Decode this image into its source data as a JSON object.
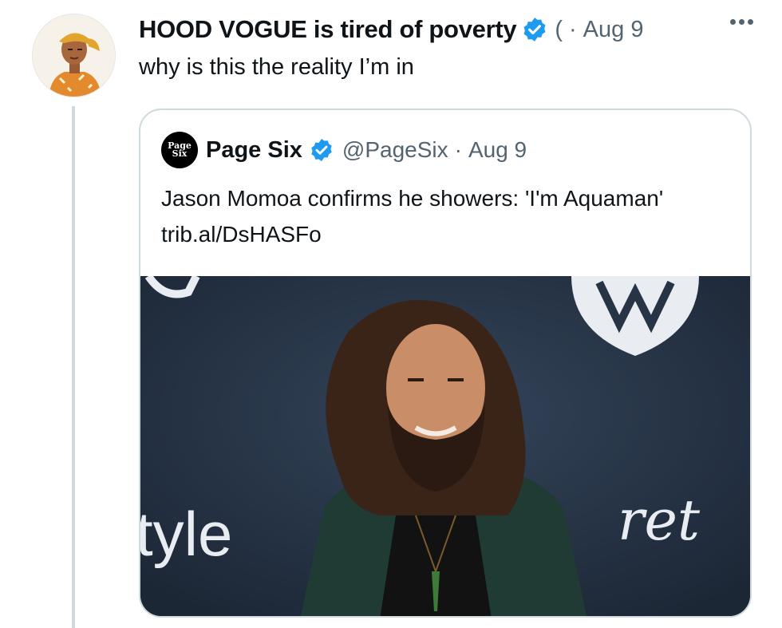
{
  "tweet": {
    "author_name": "HOOD VOGUE is tired of poverty",
    "handle_fragment": "(",
    "separator": "·",
    "date": "Aug 9",
    "text": "why is this the reality I’m in"
  },
  "quote": {
    "avatar_text_line1": "Page",
    "avatar_text_line2": "Six",
    "author_name": "Page Six",
    "handle": "@PageSix",
    "separator": "·",
    "date": "Aug 9",
    "text": "Jason Momoa confirms he showers: 'I'm Aquaman' trib.al/DsHASFo",
    "image": {
      "backdrop_text_left": "tyle",
      "backdrop_text_right": "ret"
    }
  },
  "icons": {
    "verified": "verified-badge-icon",
    "more": "more-options-icon"
  },
  "colors": {
    "verified_blue": "#1d9bf0",
    "secondary_text": "#536471",
    "border": "#cfd9de",
    "backdrop": "#263446"
  }
}
